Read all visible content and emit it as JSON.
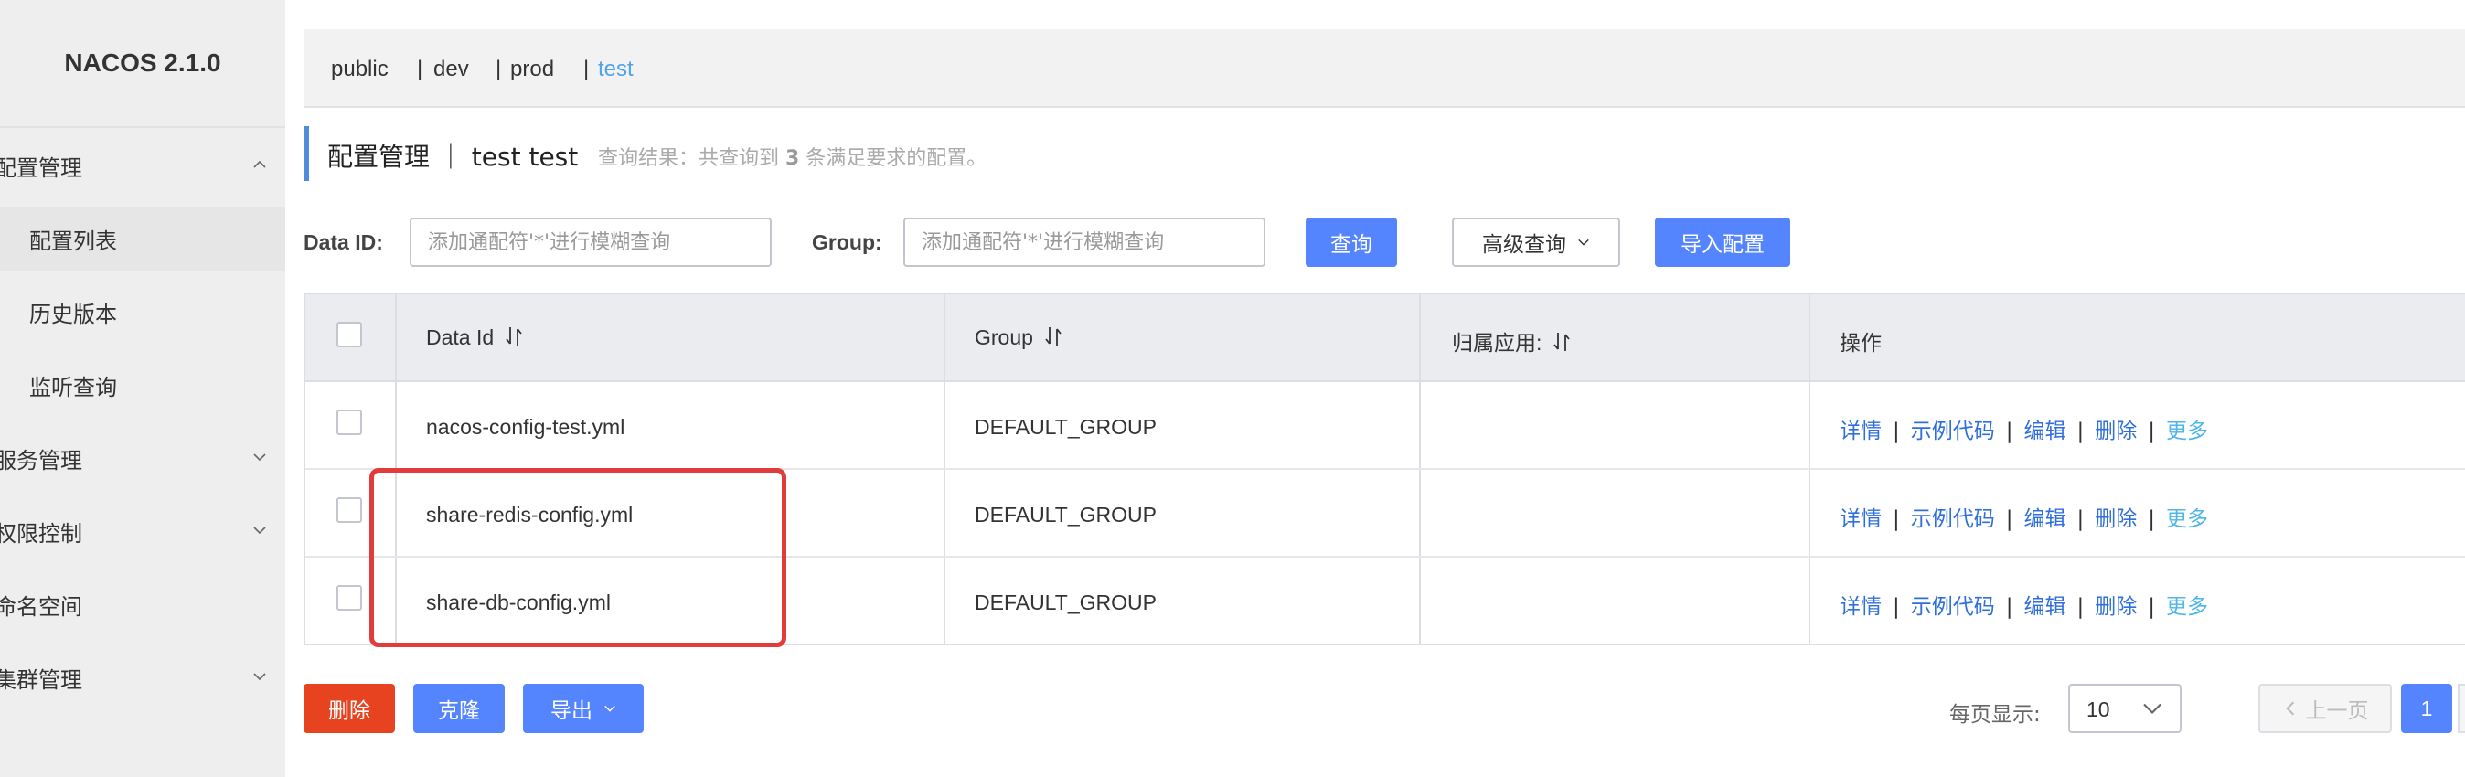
{
  "app": {
    "brand": "NACOS 2.1.0"
  },
  "sidebar": {
    "items": [
      {
        "label": "配置管理",
        "expanded": true
      },
      {
        "label": "配置列表"
      },
      {
        "label": "历史版本"
      },
      {
        "label": "监听查询"
      },
      {
        "label": "服务管理",
        "expanded": false
      },
      {
        "label": "权限控制",
        "expanded": false
      },
      {
        "label": "命名空间"
      },
      {
        "label": "集群管理",
        "expanded": false
      }
    ]
  },
  "namespaces": {
    "tabs": [
      "public",
      "dev",
      "prod",
      "test"
    ],
    "separator": "|",
    "selected": "test"
  },
  "page": {
    "title": "配置管理 ｜ test  test",
    "hint_prefix": "查询结果：共查询到 ",
    "hint_count": "3",
    "hint_suffix": " 条满足要求的配置。"
  },
  "search": {
    "dataid_label": "Data ID:",
    "dataid_placeholder": "添加通配符'*'进行模糊查询",
    "group_label": "Group:",
    "group_placeholder": "添加通配符'*'进行模糊查询",
    "query_button": "查询",
    "advanced_button": "高级查询",
    "import_button": "导入配置"
  },
  "table": {
    "headers": [
      "Data Id",
      "Group",
      "归属应用:",
      "操作"
    ],
    "rows": [
      {
        "data_id": "nacos-config-test.yml",
        "group": "DEFAULT_GROUP",
        "app": ""
      },
      {
        "data_id": "share-redis-config.yml",
        "group": "DEFAULT_GROUP",
        "app": ""
      },
      {
        "data_id": "share-db-config.yml",
        "group": "DEFAULT_GROUP",
        "app": ""
      }
    ],
    "actions": [
      "详情",
      "示例代码",
      "编辑",
      "删除",
      "更多"
    ],
    "action_separator": "|"
  },
  "bulk": {
    "delete_button": "删除",
    "clone_button": "克隆",
    "export_button": "导出"
  },
  "pagination": {
    "page_size_label": "每页显示:",
    "page_size": "10",
    "prev_button": "上一页",
    "current_page": "1"
  },
  "colors": {
    "primary": "#5584ff",
    "danger": "#e84320",
    "link": "#2f6fdc",
    "more_link": "#4fb6e8",
    "highlight_box": "#e23b3b"
  }
}
